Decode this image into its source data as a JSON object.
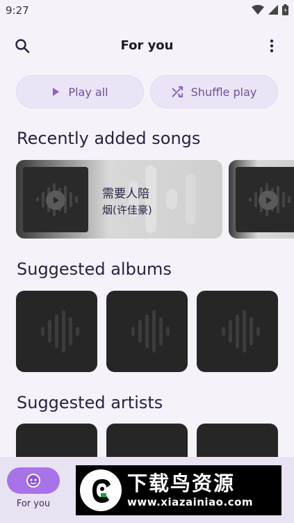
{
  "status_bar": {
    "time": "9:27"
  },
  "top_bar": {
    "title": "For you",
    "search_icon": "search-icon",
    "more_icon": "more-vert-icon"
  },
  "actions": {
    "play_all": "Play all",
    "shuffle_play": "Shuffle play"
  },
  "sections": {
    "recent": "Recently added songs",
    "albums": "Suggested albums",
    "artists": "Suggested artists"
  },
  "recent_songs": [
    {
      "title": "需要人陪",
      "artist": "烟(许佳豪)"
    }
  ],
  "bottom_nav": {
    "for_you_label": "For you",
    "icon": "smiley-face-icon"
  },
  "ad_banner": {
    "main_text": "下载鸟资源",
    "sub_text": "www.xiazainiao.com"
  },
  "colors": {
    "background": "#f6f2fa",
    "accent": "#a872e9",
    "button_bg": "#ebe3f6",
    "button_text": "#6c5294"
  }
}
